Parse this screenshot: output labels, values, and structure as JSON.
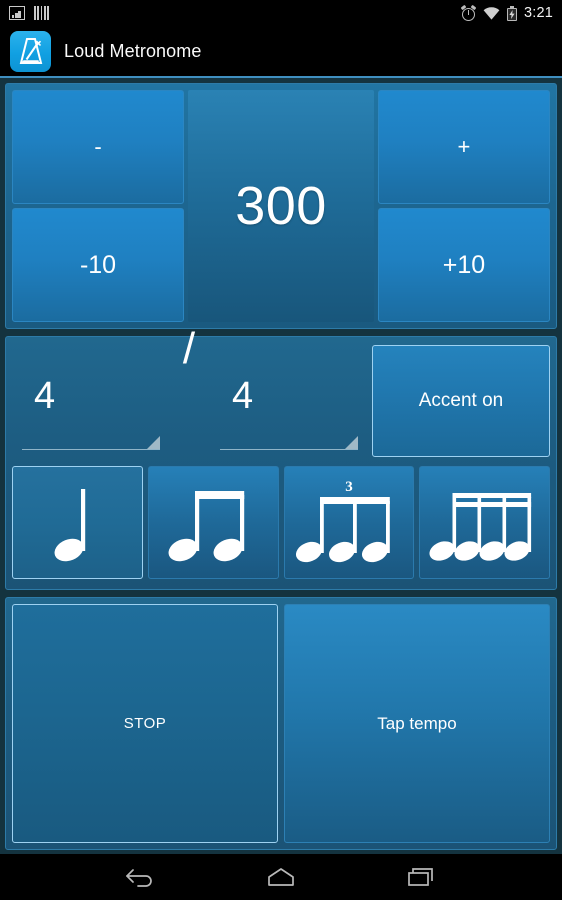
{
  "statusbar": {
    "icons_left": [
      "screenshot-icon",
      "bars-icon"
    ],
    "icons_right": [
      "alarm-icon",
      "wifi-icon",
      "battery-charging-icon"
    ],
    "clock": "3:21"
  },
  "titlebar": {
    "app_icon": "metronome-icon",
    "title": "Loud Metronome"
  },
  "tempo": {
    "minus_label": "-",
    "plus_label": "+",
    "minus10_label": "-10",
    "plus10_label": "+10",
    "bpm": "300"
  },
  "signature": {
    "numerator": "4",
    "separator": "/",
    "denominator": "4",
    "accent_label": "Accent on",
    "accent_active": true
  },
  "subdivisions": [
    {
      "name": "quarter-note",
      "label": "quarter note",
      "selected": true,
      "tuplet": ""
    },
    {
      "name": "eighth-notes",
      "label": "eighth notes",
      "selected": false,
      "tuplet": ""
    },
    {
      "name": "triplet-notes",
      "label": "triplet",
      "selected": false,
      "tuplet": "3"
    },
    {
      "name": "sixteenth-notes",
      "label": "sixteenth notes",
      "selected": false,
      "tuplet": ""
    }
  ],
  "controls": {
    "stop_label": "STOP",
    "stop_active": true,
    "tap_label": "Tap tempo"
  },
  "navbar": {
    "back": "back-icon",
    "home": "home-icon",
    "recents": "recents-icon"
  },
  "colors": {
    "accent_blue": "#2089ce",
    "panel_blue": "#1d5d82",
    "background_dark": "#14333f",
    "highlight_border": "#9ed2f2",
    "app_icon_blue": "#11a0e2"
  }
}
